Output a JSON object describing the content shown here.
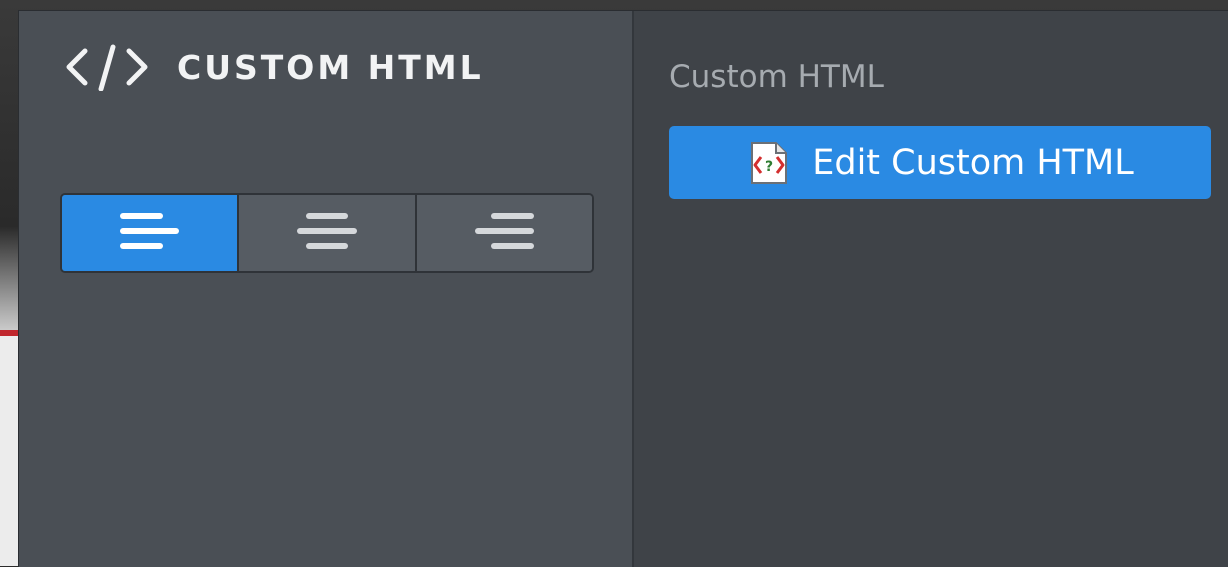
{
  "header": {
    "icon": "code-icon",
    "title": "CUSTOM HTML"
  },
  "alignment": {
    "options": [
      {
        "name": "align-left",
        "icon": "align-left-icon",
        "active": true
      },
      {
        "name": "align-center",
        "icon": "align-center-icon",
        "active": false
      },
      {
        "name": "align-right",
        "icon": "align-right-icon",
        "active": false
      }
    ]
  },
  "settings": {
    "section_label": "Custom HTML",
    "edit_button_label": "Edit Custom HTML",
    "edit_button_icon": "html-file-icon"
  },
  "colors": {
    "accent": "#2a8ae3",
    "left_pane_bg": "#4a4f55",
    "right_pane_bg": "#3f4348"
  }
}
